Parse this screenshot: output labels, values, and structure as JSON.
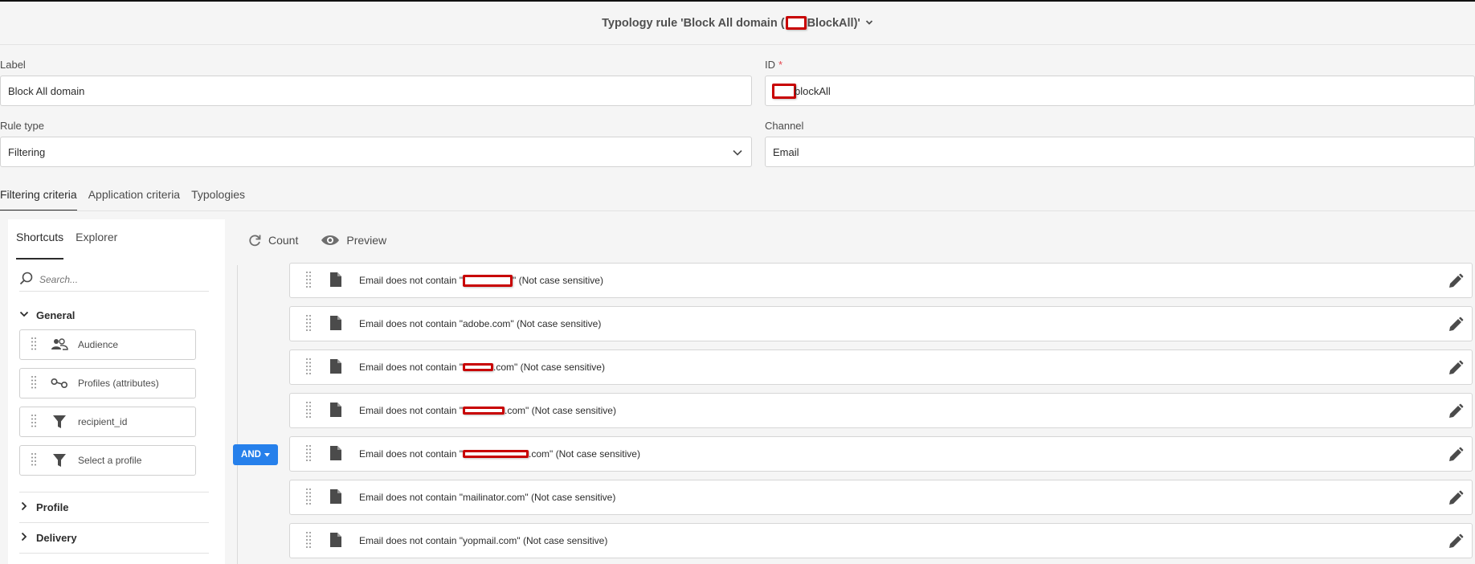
{
  "header": {
    "title_prefix": "Typology rule 'Block All domain (",
    "title_suffix": "BlockAll)'"
  },
  "form": {
    "label_caption": "Label",
    "label_value": "Block All domain",
    "id_caption": "ID",
    "id_required_mark": "*",
    "id_value_suffix": "blockAll",
    "rule_type_caption": "Rule type",
    "rule_type_value": "Filtering",
    "channel_caption": "Channel",
    "channel_value": "Email"
  },
  "tabs": [
    "Filtering criteria",
    "Application criteria",
    "Typologies"
  ],
  "left_panel": {
    "tabs": [
      "Shortcuts",
      "Explorer"
    ],
    "search_placeholder": "Search...",
    "general_label": "General",
    "shortcuts": [
      {
        "label": "Audience",
        "icon": "audience-icon"
      },
      {
        "label": "Profiles (attributes)",
        "icon": "link-icon"
      },
      {
        "label": "recipient_id",
        "icon": "filter-icon"
      },
      {
        "label": "Select a profile",
        "icon": "filter-icon"
      }
    ],
    "profile_label": "Profile",
    "delivery_label": "Delivery"
  },
  "toolbar": {
    "count_label": "Count",
    "preview_label": "Preview"
  },
  "operator_label": "AND",
  "conditions": [
    {
      "prefix": "Email does not contain \"",
      "suffix": "\" (Not case sensitive)",
      "redacted": true
    },
    {
      "prefix": "Email does not contain \"adobe.com\" (Not case sensitive)",
      "suffix": "",
      "redacted": false
    },
    {
      "prefix": "Email does not contain \"",
      "suffix": ".com\" (Not case sensitive)",
      "redacted": true
    },
    {
      "prefix": "Email does not contain \"",
      "suffix": ".com\" (Not case sensitive)",
      "redacted": true
    },
    {
      "prefix": "Email does not contain \"",
      "suffix": ".com\" (Not case sensitive)",
      "redacted": true
    },
    {
      "prefix": "Email does not contain \"mailinator.com\" (Not case sensitive)",
      "suffix": "",
      "redacted": false
    },
    {
      "prefix": "Email does not contain \"yopmail.com\" (Not case sensitive)",
      "suffix": "",
      "redacted": false
    }
  ],
  "colors": {
    "accent": "#2680eb",
    "redaction": "#c80000"
  }
}
